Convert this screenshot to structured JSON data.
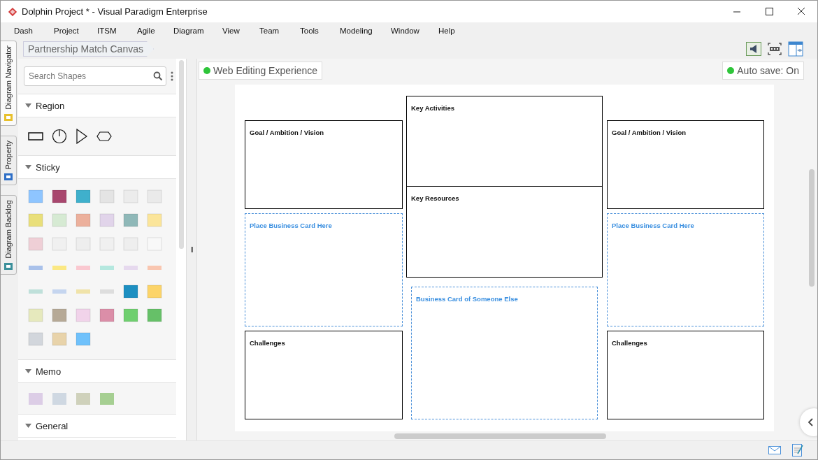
{
  "window": {
    "title": "Dolphin Project * - Visual Paradigm Enterprise"
  },
  "menu": [
    "Dash",
    "Project",
    "ITSM",
    "Agile",
    "Diagram",
    "View",
    "Team",
    "Tools",
    "Modeling",
    "Window",
    "Help"
  ],
  "side_tabs": [
    {
      "label": "Diagram Navigator",
      "selected": true
    },
    {
      "label": "Property",
      "selected": false
    },
    {
      "label": "Diagram Backlog",
      "selected": false
    }
  ],
  "breadcrumb": "Partnership Match Canvas",
  "search": {
    "placeholder": "Search Shapes"
  },
  "palette": [
    {
      "title": "Region",
      "expanded": true,
      "kind": "region"
    },
    {
      "title": "Sticky",
      "expanded": true,
      "kind": "sticky"
    },
    {
      "title": "Memo",
      "expanded": true,
      "kind": "memo"
    },
    {
      "title": "General",
      "expanded": true,
      "kind": "none"
    }
  ],
  "editing_badge": "Web Editing Experience",
  "autosave": "Auto save: On",
  "shapes": [
    {
      "label": "Key Activities",
      "kind": "box"
    },
    {
      "label": "Goal / Ambition / Vision",
      "kind": "box"
    },
    {
      "label": "Goal / Ambition / Vision",
      "kind": "box"
    },
    {
      "label": "Key Resources",
      "kind": "box"
    },
    {
      "label": "Place Business Card Here",
      "kind": "dashed"
    },
    {
      "label": "Place Business Card Here",
      "kind": "dashed"
    },
    {
      "label": "Business Card of Someone Else",
      "kind": "dashed"
    },
    {
      "label": "Challenges",
      "kind": "box"
    },
    {
      "label": "Challenges",
      "kind": "box"
    }
  ]
}
